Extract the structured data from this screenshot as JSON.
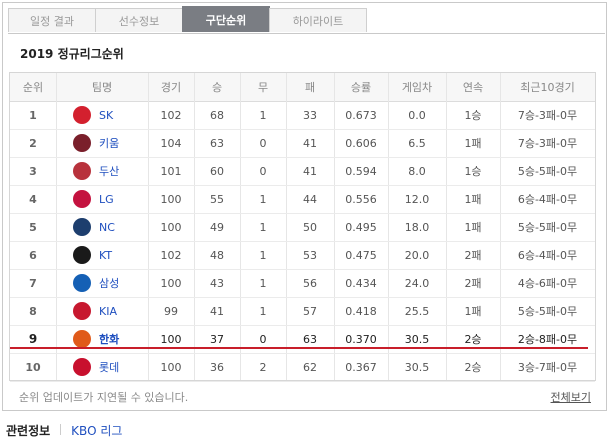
{
  "tabs": [
    {
      "label": "일정 결과",
      "active": false
    },
    {
      "label": "선수정보",
      "active": false
    },
    {
      "label": "구단순위",
      "active": true
    },
    {
      "label": "하이라이트",
      "active": false
    }
  ],
  "section_title": "2019 정규리그순위",
  "table": {
    "headers": [
      "순위",
      "팀명",
      "경기",
      "승",
      "무",
      "패",
      "승률",
      "게임차",
      "연속",
      "최근10경기"
    ],
    "rows": [
      {
        "rank": "1",
        "team": "SK",
        "games": "102",
        "win": "68",
        "draw": "1",
        "loss": "33",
        "pct": "0.673",
        "gb": "0.0",
        "streak": "1승",
        "last10": "7승-3패-0무",
        "logo_color": "#d3202e"
      },
      {
        "rank": "2",
        "team": "키움",
        "games": "104",
        "win": "63",
        "draw": "0",
        "loss": "41",
        "pct": "0.606",
        "gb": "6.5",
        "streak": "1패",
        "last10": "7승-3패-0무",
        "logo_color": "#7a1f2b"
      },
      {
        "rank": "3",
        "team": "두산",
        "games": "101",
        "win": "60",
        "draw": "0",
        "loss": "41",
        "pct": "0.594",
        "gb": "8.0",
        "streak": "1승",
        "last10": "5승-5패-0무",
        "logo_color": "#b8323c"
      },
      {
        "rank": "4",
        "team": "LG",
        "games": "100",
        "win": "55",
        "draw": "1",
        "loss": "44",
        "pct": "0.556",
        "gb": "12.0",
        "streak": "1패",
        "last10": "6승-4패-0무",
        "logo_color": "#c4123f"
      },
      {
        "rank": "5",
        "team": "NC",
        "games": "100",
        "win": "49",
        "draw": "1",
        "loss": "50",
        "pct": "0.495",
        "gb": "18.0",
        "streak": "1패",
        "last10": "5승-5패-0무",
        "logo_color": "#1d3e6e"
      },
      {
        "rank": "6",
        "team": "KT",
        "games": "102",
        "win": "48",
        "draw": "1",
        "loss": "53",
        "pct": "0.475",
        "gb": "20.0",
        "streak": "2패",
        "last10": "6승-4패-0무",
        "logo_color": "#1a1a1a"
      },
      {
        "rank": "7",
        "team": "삼성",
        "games": "100",
        "win": "43",
        "draw": "1",
        "loss": "56",
        "pct": "0.434",
        "gb": "24.0",
        "streak": "2패",
        "last10": "4승-6패-0무",
        "logo_color": "#1560b5"
      },
      {
        "rank": "8",
        "team": "KIA",
        "games": "99",
        "win": "41",
        "draw": "1",
        "loss": "57",
        "pct": "0.418",
        "gb": "25.5",
        "streak": "1패",
        "last10": "5승-5패-0무",
        "logo_color": "#c7182f"
      },
      {
        "rank": "9",
        "team": "한화",
        "games": "100",
        "win": "37",
        "draw": "0",
        "loss": "63",
        "pct": "0.370",
        "gb": "30.5",
        "streak": "2승",
        "last10": "2승-8패-0무",
        "logo_color": "#e05a1a",
        "highlight": true
      },
      {
        "rank": "10",
        "team": "롯데",
        "games": "100",
        "win": "36",
        "draw": "2",
        "loss": "62",
        "pct": "0.367",
        "gb": "30.5",
        "streak": "2승",
        "last10": "3승-7패-0무",
        "logo_color": "#c8102e"
      }
    ]
  },
  "footnote": "순위 업데이트가 지연될 수 있습니다.",
  "view_all": "전체보기",
  "related": {
    "label": "관련정보",
    "link": "KBO 리그"
  }
}
